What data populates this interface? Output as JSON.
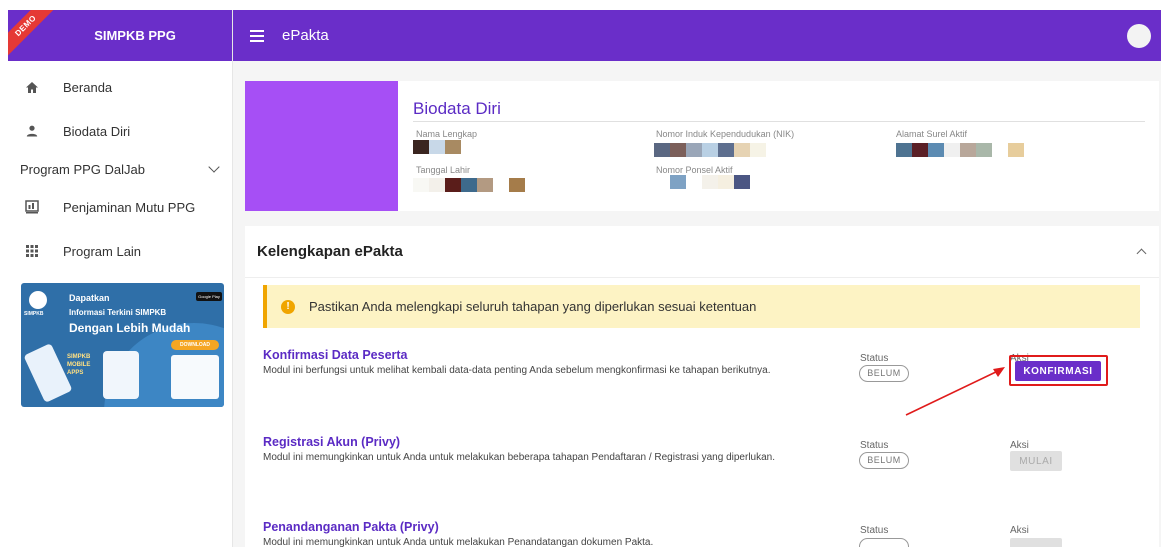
{
  "sidebar": {
    "ribbon": "DEMO",
    "brand": "SIMPKB PPG",
    "items": [
      {
        "label": "Beranda",
        "icon": "home-icon"
      },
      {
        "label": "Biodata Diri",
        "icon": "person-icon"
      }
    ],
    "group_label": "Program PPG DalJab",
    "items2": [
      {
        "label": "Penjaminan Mutu PPG",
        "icon": "report-icon"
      },
      {
        "label": "Program Lain",
        "icon": "apps-grid-icon"
      }
    ],
    "promo": {
      "logo_text": "SIMPKB",
      "line1": "Dapatkan",
      "line2": "Informasi Terkini SIMPKB",
      "line3": "Dengan Lebih Mudah",
      "store_badge": "Google Play",
      "download": "DOWNLOAD",
      "mobile_apps": "SIMPKB MOBILE APPS"
    }
  },
  "topbar": {
    "title": "ePakta"
  },
  "biodata": {
    "title": "Biodata Diri",
    "fields": {
      "nama": "Nama Lengkap",
      "nik": "Nomor Induk Kependudukan (NIK)",
      "email": "Alamat Surel Aktif",
      "tgl": "Tanggal Lahir",
      "hp": "Nomor Ponsel Aktif"
    }
  },
  "kelengkapan": {
    "title": "Kelengkapan ePakta",
    "alert": "Pastikan Anda melengkapi seluruh tahapan yang diperlukan sesuai ketentuan",
    "steps": [
      {
        "title": "Konfirmasi Data Peserta",
        "desc": "Modul ini berfungsi untuk melihat kembali data-data penting Anda sebelum mengkonfirmasi ke tahapan berikutnya.",
        "status_label": "Status",
        "status": "BELUM",
        "aksi_label": "Aksi",
        "action": "KONFIRMASI"
      },
      {
        "title": "Registrasi Akun (Privy)",
        "desc": "Modul ini memungkinkan untuk Anda untuk melakukan beberapa tahapan Pendaftaran / Registrasi yang diperlukan.",
        "status_label": "Status",
        "status": "BELUM",
        "aksi_label": "Aksi",
        "action": "MULAI"
      },
      {
        "title": "Penandanganan Pakta (Privy)",
        "desc": "Modul ini memungkinkan untuk Anda untuk melakukan Penandatangan dokumen Pakta.",
        "status_label": "Status",
        "aksi_label": "Aksi"
      }
    ]
  },
  "colors": {
    "primary": "#6a2ec9",
    "photo": "#a64ff5",
    "alert_bg": "#fdf3c4",
    "alert_accent": "#f0a500",
    "highlight": "#e01b1b"
  }
}
